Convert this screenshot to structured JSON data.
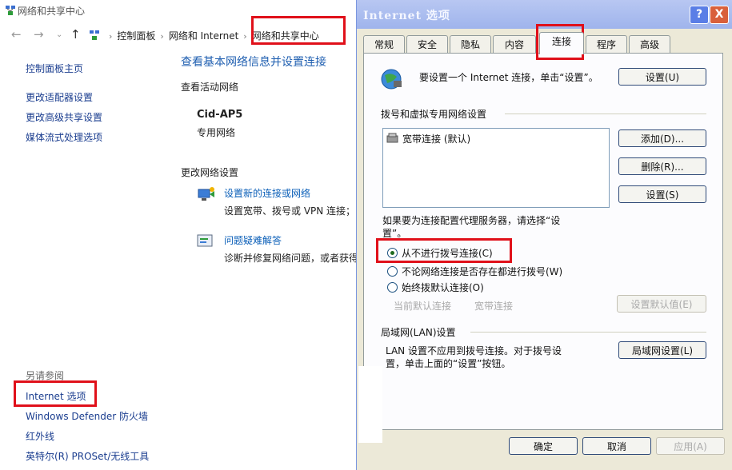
{
  "control_panel": {
    "window_title": "网络和共享中心",
    "breadcrumb": [
      "控制面板",
      "网络和 Internet",
      "网络和共享中心"
    ],
    "sidebar": {
      "home": "控制面板主页",
      "links": [
        "更改适配器设置",
        "更改高级共享设置",
        "媒体流式处理选项"
      ],
      "see_also_label": "另请参阅",
      "see_also": [
        "Internet 选项",
        "Windows Defender 防火墙",
        "红外线",
        "英特尔(R) PROSet/无线工具"
      ]
    },
    "main": {
      "heading": "查看基本网络信息并设置连接",
      "active_label": "查看活动网络",
      "network_name": "Cid-AP5",
      "network_type": "专用网络",
      "change_label": "更改网络设置",
      "setup_link": "设置新的连接或网络",
      "setup_desc": "设置宽带、拨号或 VPN 连接；",
      "troubleshoot_link": "问题疑难解答",
      "troubleshoot_desc": "诊断并修复网络问题，或者获得"
    }
  },
  "dialog": {
    "title": "Internet 选项",
    "help": "?",
    "close": "X",
    "tabs": [
      "常规",
      "安全",
      "隐私",
      "内容",
      "连接",
      "程序",
      "高级"
    ],
    "active_tab": "连接",
    "setup_text": "要设置一个 Internet 连接，单击“设置”。",
    "setup_button": "设置(U)",
    "dialup_section": "拨号和虚拟专用网络设置",
    "connections": [
      "宽带连接 (默认)"
    ],
    "add_button": "添加(D)...",
    "remove_button": "删除(R)...",
    "settings_button": "设置(S)",
    "proxy_text_1": "如果要为连接配置代理服务器，请选择“设",
    "proxy_text_2": "置”。",
    "radio_options": [
      "从不进行拨号连接(C)",
      "不论网络连接是否存在都进行拨号(W)",
      "始终拨默认连接(O)"
    ],
    "current_default_label": "当前默认连接",
    "current_default_value": "宽带连接",
    "set_default_button": "设置默认值(E)",
    "lan_section": "局域网(LAN)设置",
    "lan_text_1": "LAN 设置不应用到拨号连接。对于拨号设",
    "lan_text_2": "置，单击上面的“设置”按钮。",
    "lan_button": "局域网设置(L)",
    "ok_button": "确定",
    "cancel_button": "取消",
    "apply_button": "应用(A)"
  }
}
